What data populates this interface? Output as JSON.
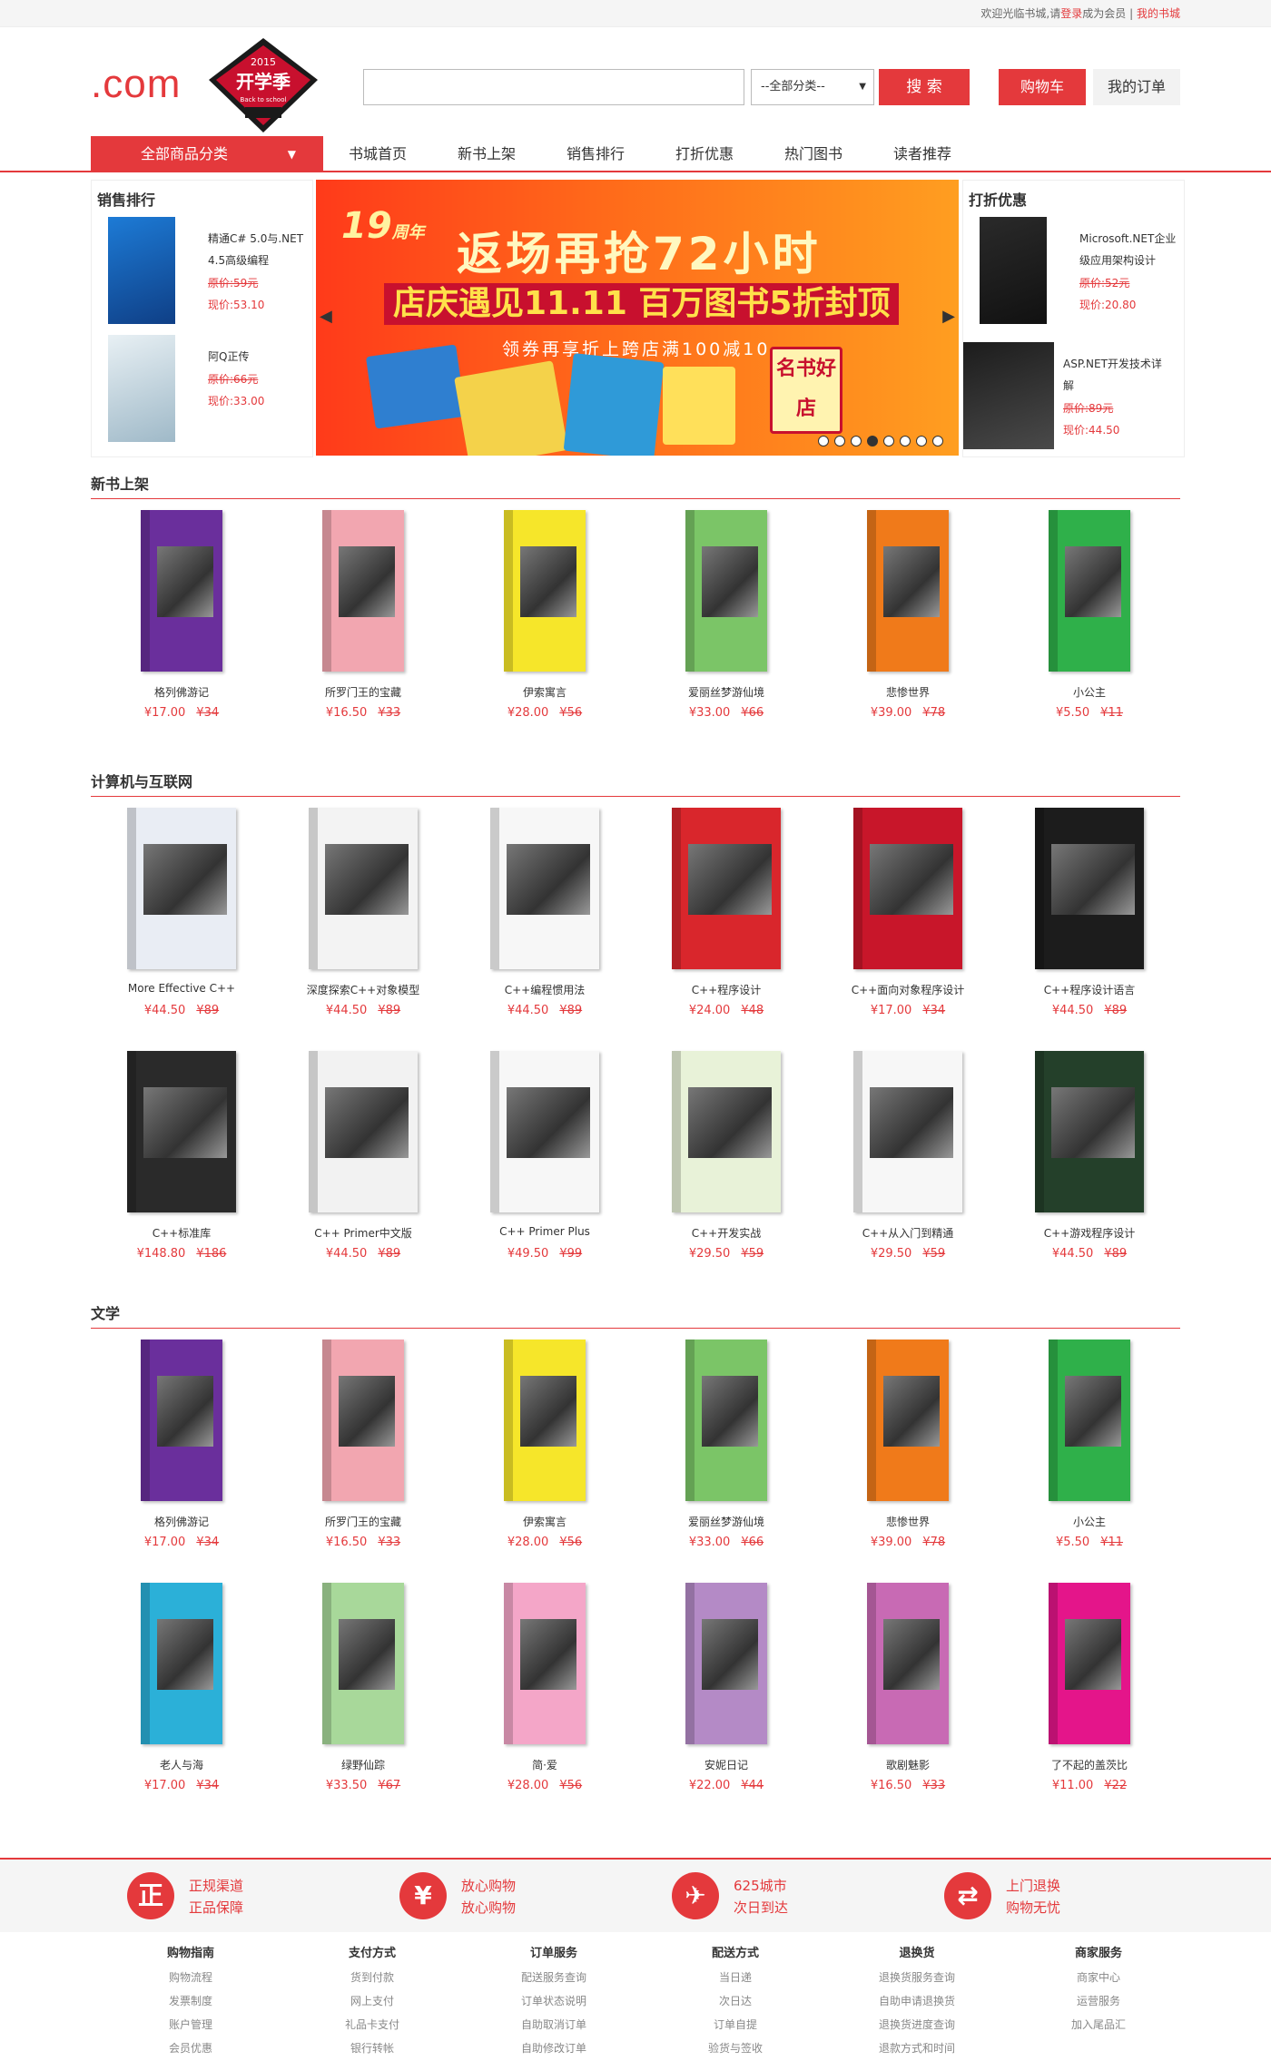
{
  "topbar": {
    "welcome": "欢迎光临书城,请",
    "login": "登录",
    "become": "成为会员",
    "sep": "|",
    "my_books": "我的书城"
  },
  "header": {
    "logo_text": ".com",
    "badge_year": "2015",
    "badge_title": "开学季",
    "badge_sub": "Back to school",
    "search_placeholder": "",
    "category_selected": "--全部分类--",
    "search_label": "搜 索",
    "cart_label": "购物车",
    "orders_label": "我的订单"
  },
  "nav": {
    "all_label": "全部商品分类",
    "links": [
      "书城首页",
      "新书上架",
      "销售排行",
      "打折优惠",
      "热门图书",
      "读者推荐"
    ]
  },
  "sales_rank": {
    "title": "销售排行",
    "items": [
      {
        "title": "精通C# 5.0与.NET 4.5高级编程",
        "old": "原价:59元",
        "now": "现价:53.10"
      },
      {
        "title": "阿Q正传",
        "old": "原价:66元",
        "now": "现价:33.00"
      }
    ]
  },
  "discount": {
    "title": "打折优惠",
    "items": [
      {
        "title": "Microsoft.NET企业级应用架构设计",
        "old": "原价:52元",
        "now": "现价:20.80"
      },
      {
        "title": "ASP.NET开发技术详解",
        "old": "原价:89元",
        "now": "现价:44.50"
      }
    ]
  },
  "banner": {
    "anniv": "19",
    "anniv_suffix": "周年",
    "headline": "返场再抢72小时",
    "subline": "店庆遇见11.11 百万图书5折封顶",
    "promo": "领券再享折上跨店满100减10",
    "tag": "名书好店",
    "slides": 8,
    "active_slide": 4
  },
  "sections": [
    {
      "title": "新书上架",
      "books": [
        {
          "name": "格列佛游记",
          "now": "¥17.00",
          "old": "¥34",
          "color": "#6a2f9c"
        },
        {
          "name": "所罗门王的宝藏",
          "now": "¥16.50",
          "old": "¥33",
          "color": "#f2a6b0"
        },
        {
          "name": "伊索寓言",
          "now": "¥28.00",
          "old": "¥56",
          "color": "#f6e62a"
        },
        {
          "name": "爱丽丝梦游仙境",
          "now": "¥33.00",
          "old": "¥66",
          "color": "#7bc567"
        },
        {
          "name": "悲惨世界",
          "now": "¥39.00",
          "old": "¥78",
          "color": "#f07a1a"
        },
        {
          "name": "小公主",
          "now": "¥5.50",
          "old": "¥11",
          "color": "#2fb04a"
        }
      ]
    },
    {
      "title": "计算机与互联网",
      "books": [
        {
          "name": "More Effective C++",
          "now": "¥44.50",
          "old": "¥89",
          "color": "#e9edf4"
        },
        {
          "name": "深度探索C++对象模型",
          "now": "¥44.50",
          "old": "¥89",
          "color": "#f3f3f3"
        },
        {
          "name": "C++编程惯用法",
          "now": "¥44.50",
          "old": "¥89",
          "color": "#f7f7f7"
        },
        {
          "name": "C++程序设计",
          "now": "¥24.00",
          "old": "¥48",
          "color": "#d9262c"
        },
        {
          "name": "C++面向对象程序设计",
          "now": "¥17.00",
          "old": "¥34",
          "color": "#c8162a"
        },
        {
          "name": "C++程序设计语言",
          "now": "¥44.50",
          "old": "¥89",
          "color": "#1c1c1c"
        },
        {
          "name": "C++标准库",
          "now": "¥148.80",
          "old": "¥186",
          "color": "#2a2a2a"
        },
        {
          "name": "C++ Primer中文版",
          "now": "¥44.50",
          "old": "¥89",
          "color": "#f2f2f2"
        },
        {
          "name": "C++ Primer Plus",
          "now": "¥49.50",
          "old": "¥99",
          "color": "#f7f7f7"
        },
        {
          "name": "C++开发实战",
          "now": "¥29.50",
          "old": "¥59",
          "color": "#e8f2d8"
        },
        {
          "name": "C++从入门到精通",
          "now": "¥29.50",
          "old": "¥59",
          "color": "#f7f7f7"
        },
        {
          "name": "C++游戏程序设计",
          "now": "¥44.50",
          "old": "¥89",
          "color": "#24402a"
        }
      ]
    },
    {
      "title": "文学",
      "books": [
        {
          "name": "格列佛游记",
          "now": "¥17.00",
          "old": "¥34",
          "color": "#6a2f9c"
        },
        {
          "name": "所罗门王的宝藏",
          "now": "¥16.50",
          "old": "¥33",
          "color": "#f2a6b0"
        },
        {
          "name": "伊索寓言",
          "now": "¥28.00",
          "old": "¥56",
          "color": "#f6e62a"
        },
        {
          "name": "爱丽丝梦游仙境",
          "now": "¥33.00",
          "old": "¥66",
          "color": "#7bc567"
        },
        {
          "name": "悲惨世界",
          "now": "¥39.00",
          "old": "¥78",
          "color": "#f07a1a"
        },
        {
          "name": "小公主",
          "now": "¥5.50",
          "old": "¥11",
          "color": "#2fb04a"
        },
        {
          "name": "老人与海",
          "now": "¥17.00",
          "old": "¥34",
          "color": "#2bb0d8"
        },
        {
          "name": "绿野仙踪",
          "now": "¥33.50",
          "old": "¥67",
          "color": "#a8d89a"
        },
        {
          "name": "简·爱",
          "now": "¥28.00",
          "old": "¥56",
          "color": "#f4a6c8"
        },
        {
          "name": "安妮日记",
          "now": "¥22.00",
          "old": "¥44",
          "color": "#b48ac6"
        },
        {
          "name": "歌剧魅影",
          "now": "¥16.50",
          "old": "¥33",
          "color": "#c86ab4"
        },
        {
          "name": "了不起的盖茨比",
          "now": "¥11.00",
          "old": "¥22",
          "color": "#e4158a"
        }
      ]
    }
  ],
  "services": [
    {
      "icon": "正",
      "l1": "正规渠道",
      "l2": "正品保障"
    },
    {
      "icon": "¥",
      "l1": "放心购物",
      "l2": "放心购物"
    },
    {
      "icon": "✈",
      "l1": "625城市",
      "l2": "次日到达"
    },
    {
      "icon": "⇄",
      "l1": "上门退换",
      "l2": "购物无忧"
    }
  ],
  "footer": [
    {
      "title": "购物指南",
      "links": [
        "购物流程",
        "发票制度",
        "账户管理",
        "会员优惠"
      ]
    },
    {
      "title": "支付方式",
      "links": [
        "货到付款",
        "网上支付",
        "礼品卡支付",
        "银行转帐"
      ]
    },
    {
      "title": "订单服务",
      "links": [
        "配送服务查询",
        "订单状态说明",
        "自助取消订单",
        "自助修改订单"
      ]
    },
    {
      "title": "配送方式",
      "links": [
        "当日递",
        "次日达",
        "订单自提",
        "验货与签收"
      ]
    },
    {
      "title": "退换货",
      "links": [
        "退换货服务查询",
        "自助申请退换货",
        "退换货进度查询",
        "退款方式和时间"
      ]
    },
    {
      "title": "商家服务",
      "links": [
        "商家中心",
        "运营服务",
        "加入尾品汇"
      ]
    }
  ],
  "colors": {
    "accent": "#e4393c"
  }
}
